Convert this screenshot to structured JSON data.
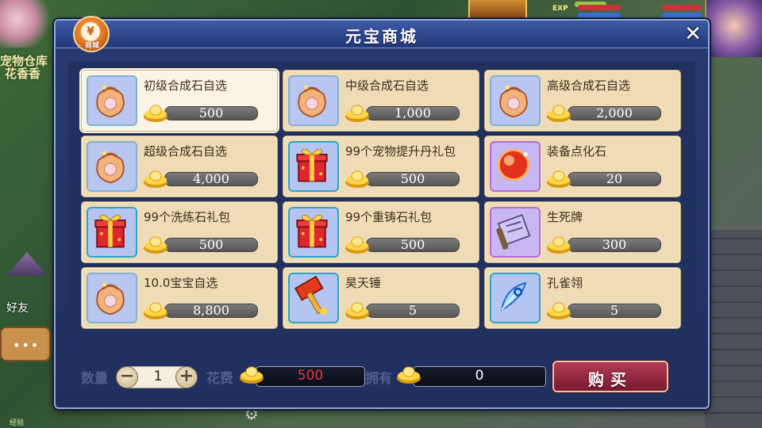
{
  "background": {
    "pet_storage_label": "宠物仓库",
    "player_name": "花香香",
    "exp_label": "EXP",
    "friend_label": "好友",
    "chat_label": "•••",
    "bottom_label": "经验"
  },
  "shop": {
    "title": "元宝商城",
    "badge_label": "商城",
    "close_label": "✕",
    "items": [
      {
        "name": "初级合成石自选",
        "price": "500",
        "icon": "bag-icon",
        "selected": true
      },
      {
        "name": "中级合成石自选",
        "price": "1,000",
        "icon": "bag-icon"
      },
      {
        "name": "高级合成石自选",
        "price": "2,000",
        "icon": "bag-icon"
      },
      {
        "name": "超级合成石自选",
        "price": "4,000",
        "icon": "bag-icon"
      },
      {
        "name": "99个宠物提升丹礼包",
        "price": "500",
        "icon": "gift-box-icon"
      },
      {
        "name": "装备点化石",
        "price": "20",
        "icon": "red-orb-icon"
      },
      {
        "name": "99个洗练石礼包",
        "price": "500",
        "icon": "gift-box-icon"
      },
      {
        "name": "99个重铸石礼包",
        "price": "500",
        "icon": "gift-box-icon"
      },
      {
        "name": "生死牌",
        "price": "300",
        "icon": "scroll-icon"
      },
      {
        "name": "10.0宝宝自选",
        "price": "8,800",
        "icon": "bag-icon"
      },
      {
        "name": "昊天锤",
        "price": "5",
        "icon": "hammer-icon"
      },
      {
        "name": "孔雀翎",
        "price": "5",
        "icon": "feather-icon"
      }
    ],
    "quantity_label": "数量",
    "quantity_value": "1",
    "minus_label": "−",
    "plus_label": "+",
    "cost_label": "花费",
    "cost_value": "500",
    "owned_label": "拥有",
    "owned_value": "0",
    "buy_label": "购买"
  },
  "colors": {
    "dialog": "#283a70",
    "card": "#efdcb7",
    "buy_button": "#9a2a44",
    "cost_text": "#e23b3b"
  }
}
